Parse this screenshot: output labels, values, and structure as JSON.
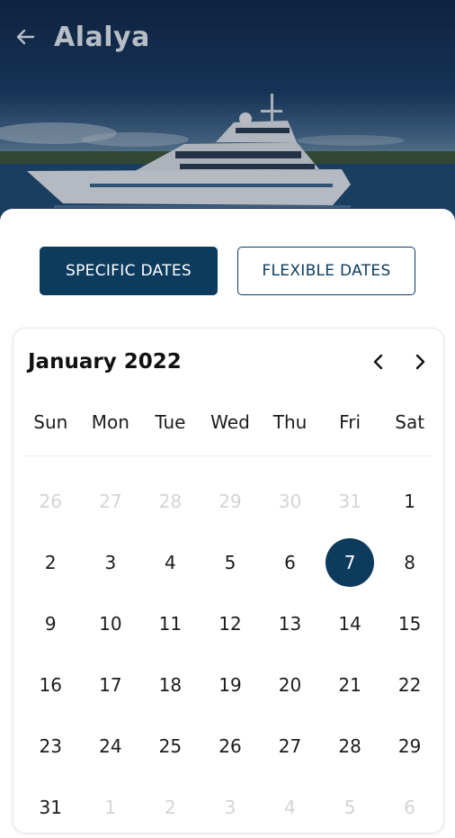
{
  "header": {
    "title": "Alalya",
    "back_icon": "arrow-left-icon"
  },
  "date_mode": {
    "specific_label": "SPECIFIC DATES",
    "flexible_label": "FLEXIBLE DATES",
    "selected": "specific"
  },
  "calendar": {
    "month_label": "January 2022",
    "prev_icon": "chevron-left-icon",
    "next_icon": "chevron-right-icon",
    "weekdays": [
      "Sun",
      "Mon",
      "Tue",
      "Wed",
      "Thu",
      "Fri",
      "Sat"
    ],
    "selected_day": "7",
    "weeks": [
      [
        {
          "d": "26",
          "m": true
        },
        {
          "d": "27",
          "m": true
        },
        {
          "d": "28",
          "m": true
        },
        {
          "d": "29",
          "m": true
        },
        {
          "d": "30",
          "m": true
        },
        {
          "d": "31",
          "m": true
        },
        {
          "d": "1",
          "m": false
        }
      ],
      [
        {
          "d": "2",
          "m": false
        },
        {
          "d": "3",
          "m": false
        },
        {
          "d": "4",
          "m": false
        },
        {
          "d": "5",
          "m": false
        },
        {
          "d": "6",
          "m": false
        },
        {
          "d": "7",
          "m": false
        },
        {
          "d": "8",
          "m": false
        }
      ],
      [
        {
          "d": "9",
          "m": false
        },
        {
          "d": "10",
          "m": false
        },
        {
          "d": "11",
          "m": false
        },
        {
          "d": "12",
          "m": false
        },
        {
          "d": "13",
          "m": false
        },
        {
          "d": "14",
          "m": false
        },
        {
          "d": "15",
          "m": false
        }
      ],
      [
        {
          "d": "16",
          "m": false
        },
        {
          "d": "17",
          "m": false
        },
        {
          "d": "18",
          "m": false
        },
        {
          "d": "19",
          "m": false
        },
        {
          "d": "20",
          "m": false
        },
        {
          "d": "21",
          "m": false
        },
        {
          "d": "22",
          "m": false
        }
      ],
      [
        {
          "d": "23",
          "m": false
        },
        {
          "d": "24",
          "m": false
        },
        {
          "d": "25",
          "m": false
        },
        {
          "d": "26",
          "m": false
        },
        {
          "d": "27",
          "m": false
        },
        {
          "d": "28",
          "m": false
        },
        {
          "d": "29",
          "m": false
        }
      ],
      [
        {
          "d": "31",
          "m": false
        },
        {
          "d": "1",
          "m": true
        },
        {
          "d": "2",
          "m": true
        },
        {
          "d": "3",
          "m": true
        },
        {
          "d": "4",
          "m": true
        },
        {
          "d": "5",
          "m": true
        },
        {
          "d": "6",
          "m": true
        }
      ]
    ]
  },
  "colors": {
    "primary": "#0d3b5e",
    "muted_text": "#d4d4d4"
  }
}
